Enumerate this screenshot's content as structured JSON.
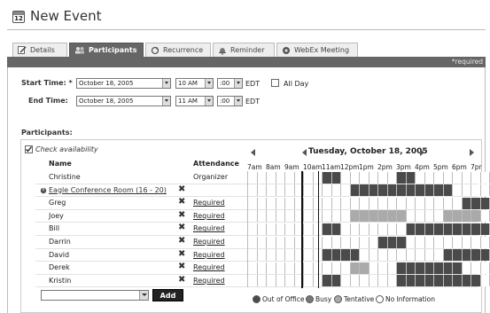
{
  "page": {
    "title": "New Event",
    "calendar_icon_day": "12"
  },
  "tabs": [
    {
      "label": "Details",
      "icon": "pencil-icon",
      "active": false
    },
    {
      "label": "Participants",
      "icon": "people-icon",
      "active": true
    },
    {
      "label": "Recurrence",
      "icon": "recurrence-icon",
      "active": false
    },
    {
      "label": "Reminder",
      "icon": "bell-icon",
      "active": false
    },
    {
      "label": "WebEx Meeting",
      "icon": "webex-icon",
      "active": false
    }
  ],
  "required_note": "*required",
  "start": {
    "label": "Start Time: *",
    "date": "October 18, 2005",
    "hour": "10 AM",
    "minute": ":00",
    "tz": "EDT",
    "all_day_label": "All Day"
  },
  "end": {
    "label": "End Time:",
    "date": "October 18, 2005",
    "hour": "11 AM",
    "minute": ":00",
    "tz": "EDT"
  },
  "participants": {
    "label": "Participants:",
    "check_availability": "Check availability",
    "name_header": "Name",
    "attendance_header": "Attendance",
    "rows": [
      {
        "name": "Christine",
        "attendance": "Organizer",
        "link": false,
        "removable": false,
        "resource": false
      },
      {
        "name": "Eagle Conference Room (16 - 20)",
        "attendance": "",
        "link": true,
        "removable": true,
        "resource": true
      },
      {
        "name": "Greg",
        "attendance": "Required",
        "link": false,
        "removable": true,
        "resource": false
      },
      {
        "name": "Joey",
        "attendance": "Required",
        "link": false,
        "removable": true,
        "resource": false
      },
      {
        "name": "Bill",
        "attendance": "Required",
        "link": false,
        "removable": true,
        "resource": false
      },
      {
        "name": "Darrin",
        "attendance": "Required",
        "link": false,
        "removable": true,
        "resource": false
      },
      {
        "name": "David",
        "attendance": "Required",
        "link": false,
        "removable": true,
        "resource": false
      },
      {
        "name": "Derek",
        "attendance": "Required",
        "link": false,
        "removable": true,
        "resource": false
      },
      {
        "name": "Kristin",
        "attendance": "Required",
        "link": false,
        "removable": true,
        "resource": false
      }
    ]
  },
  "schedule": {
    "date": "Tuesday, October 18, 2005",
    "hours": [
      "7am",
      "8am",
      "9am",
      "10am",
      "11am",
      "12pm",
      "1pm",
      "2pm",
      "3pm",
      "4pm",
      "5pm",
      "6pm",
      "7pr"
    ],
    "slot_codes": {
      "o": "out-of-office",
      "b": "busy",
      "t": "tentative",
      ".": "free"
    },
    "availability": [
      "........oo......oo..........",
      "...........ooooooooooo......",
      ".......................ooooo",
      "...........tttttt....tttt...",
      "........oo.......oooooooooo.",
      "..............ooo...........",
      "........oooo.........oooooo.",
      "...........tt...ooooooo.....",
      "........oo......ooooooooo..."
    ]
  },
  "add_button": "Add",
  "legend": [
    {
      "label": "Out of Office",
      "color": "#4a4a4a"
    },
    {
      "label": "Busy",
      "color": "#777777"
    },
    {
      "label": "Tentative",
      "color": "#aaaaaa"
    },
    {
      "label": "No Information",
      "color": "#ffffff"
    }
  ]
}
